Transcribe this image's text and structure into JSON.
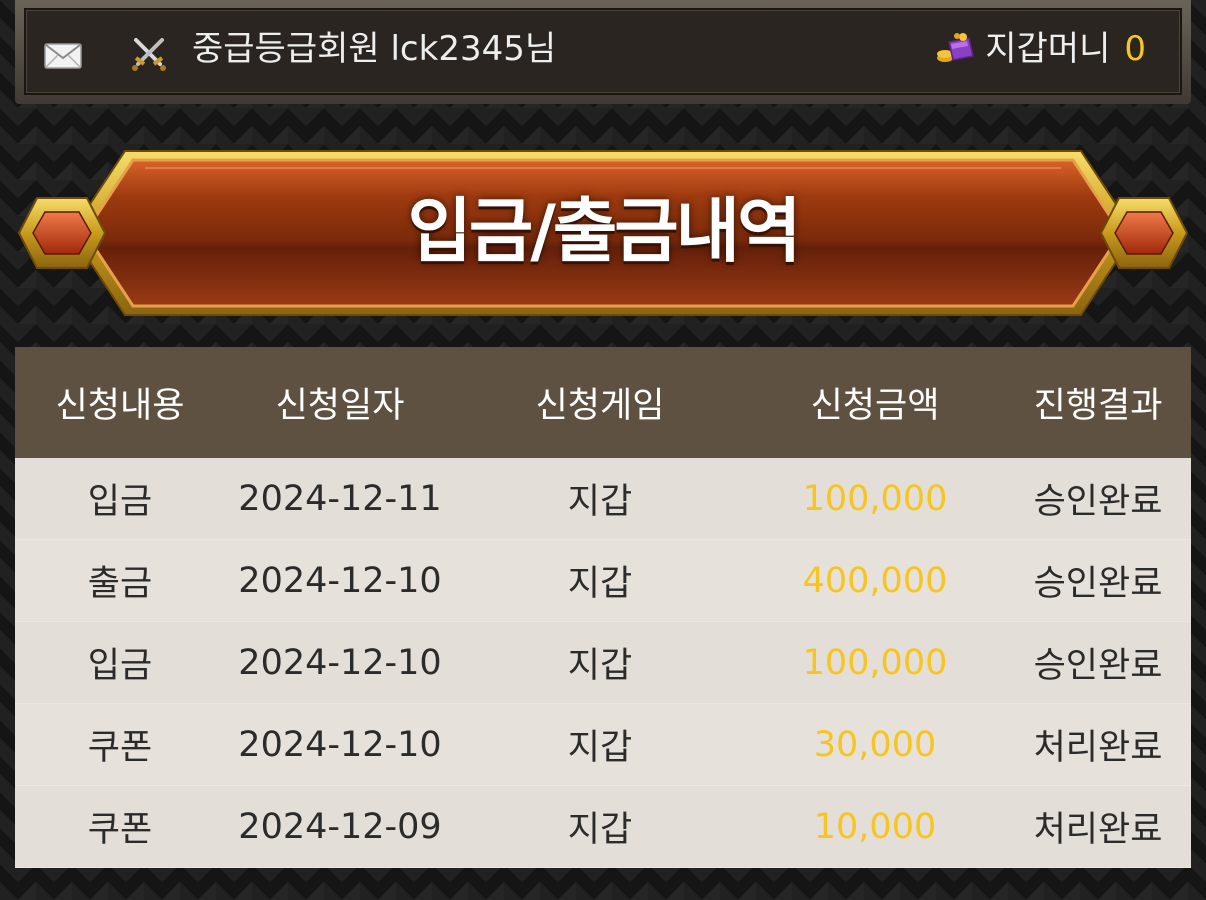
{
  "header": {
    "member_text": "중급등급회원 lck2345님",
    "wallet_label": "지갑머니",
    "wallet_amount": "0",
    "icons": [
      "mail-icon",
      "crossed-swords-icon",
      "wallet-icon"
    ],
    "accent_color": "#f7c520"
  },
  "banner": {
    "title": "입금/출금내역"
  },
  "table": {
    "headers": [
      "신청내용",
      "신청일자",
      "신청게임",
      "신청금액",
      "진행결과"
    ],
    "rows": [
      {
        "type": "입금",
        "date": "2024-12-11",
        "game": "지갑",
        "amount": "100,000",
        "result": "승인완료"
      },
      {
        "type": "출금",
        "date": "2024-12-10",
        "game": "지갑",
        "amount": "400,000",
        "result": "승인완료"
      },
      {
        "type": "입금",
        "date": "2024-12-10",
        "game": "지갑",
        "amount": "100,000",
        "result": "승인완료"
      },
      {
        "type": "쿠폰",
        "date": "2024-12-10",
        "game": "지갑",
        "amount": "30,000",
        "result": "처리완료"
      },
      {
        "type": "쿠폰",
        "date": "2024-12-09",
        "game": "지갑",
        "amount": "10,000",
        "result": "처리완료"
      }
    ]
  }
}
